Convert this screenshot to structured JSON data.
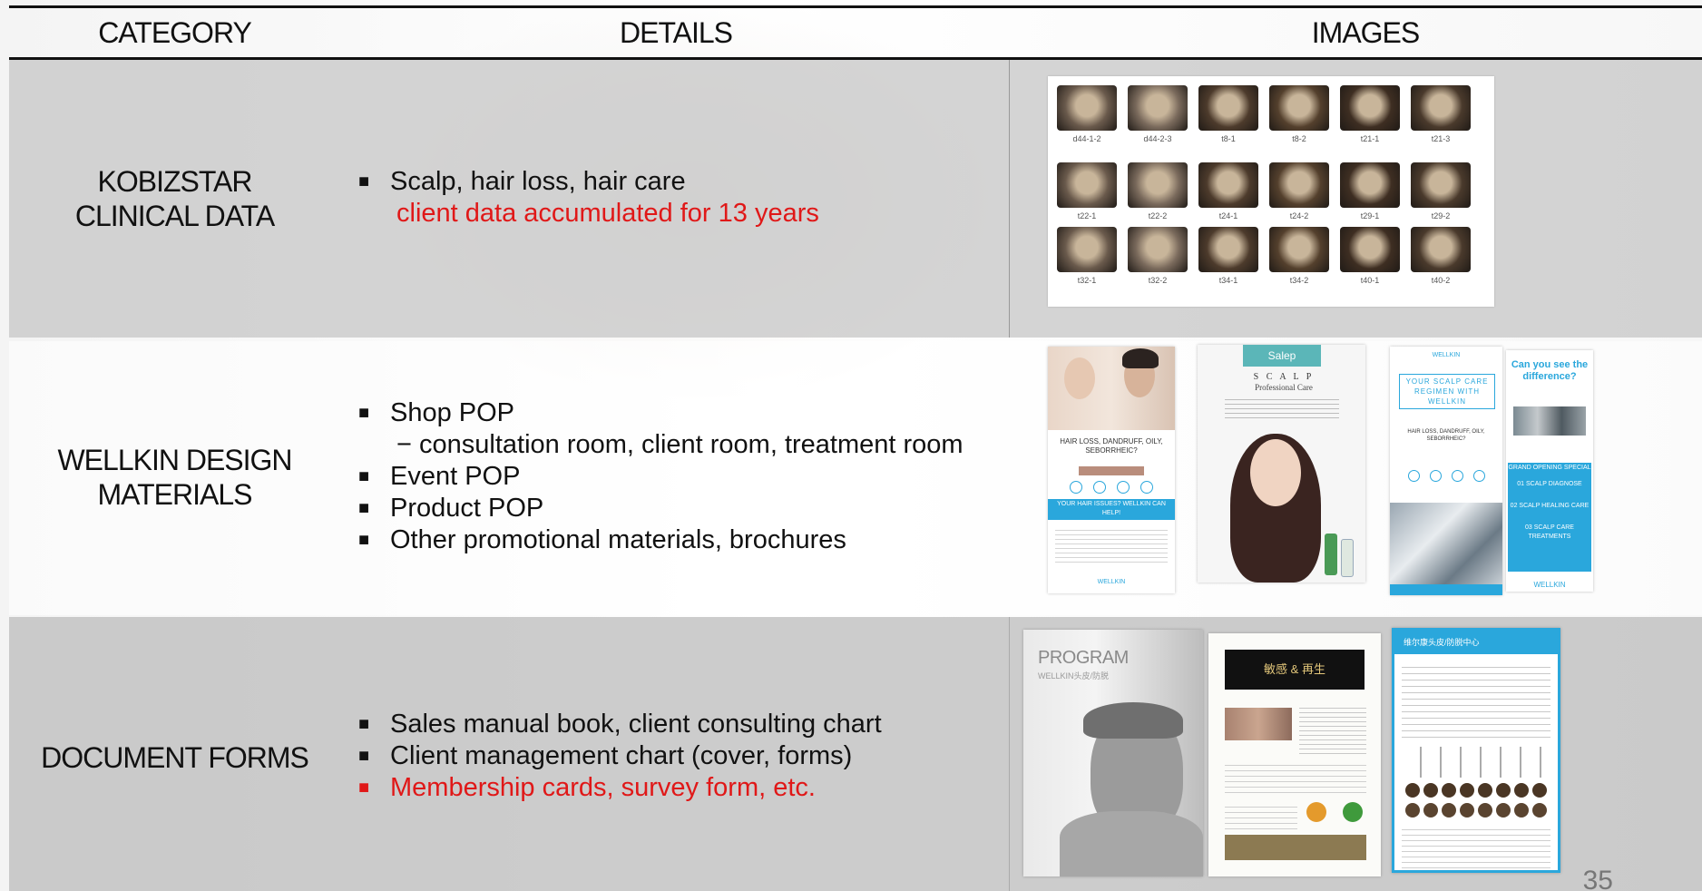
{
  "header": {
    "category": "CATEGORY",
    "details": "DETAILS",
    "images": "IMAGES"
  },
  "rows": [
    {
      "category": [
        "KOBIZSTAR",
        "CLINICAL DATA"
      ],
      "details": [
        {
          "text": "Scalp, hair loss, hair care",
          "bullet": true,
          "red": false
        },
        {
          "text": "client data accumulated for 13 years",
          "bullet": false,
          "red": true
        }
      ]
    },
    {
      "category": [
        "WELLKIN DESIGN",
        "MATERIALS"
      ],
      "details": [
        {
          "text": "Shop POP",
          "bullet": true,
          "red": false
        },
        {
          "text": "− consultation room, client room, treatment room",
          "bullet": false,
          "red": false
        },
        {
          "text": "Event POP",
          "bullet": true,
          "red": false
        },
        {
          "text": "Product POP",
          "bullet": true,
          "red": false
        },
        {
          "text": "Other promotional materials, brochures",
          "bullet": true,
          "red": false
        }
      ]
    },
    {
      "category": [
        "DOCUMENT FORMS"
      ],
      "details": [
        {
          "text": "Sales manual book, client consulting chart",
          "bullet": true,
          "red": false
        },
        {
          "text": "Client management chart (cover, forms)",
          "bullet": true,
          "red": false
        },
        {
          "text": "Membership cards, survey form, etc.",
          "bullet": true,
          "red": true
        }
      ]
    }
  ],
  "clinical_captions": [
    "d44-1-2",
    "d44-2-3",
    "t8-1",
    "t8-2",
    "t21-1",
    "t21-3",
    "t22-1",
    "t22-2",
    "t24-1",
    "t24-2",
    "t29-1",
    "t29-2",
    "t32-1",
    "t32-2",
    "t34-1",
    "t34-2",
    "t40-1",
    "t40-2"
  ],
  "materials": {
    "card1_heading": "HAIR LOSS, DANDRUFF, OILY, SEBORRHEIC?",
    "card1_banner": "YOUR HAIR ISSUES? WELLKIN CAN HELP!",
    "card1_logo": "WELLKIN",
    "card2_brand": "Salep",
    "card2_title": "S C A L P",
    "card2_subtitle": "Professional Care",
    "card3_logo": "WELLKIN",
    "card3_title": "YOUR SCALP CARE REGIMEN WITH WELLKIN",
    "card3_heading": "HAIR LOSS, DANDRUFF, OILY, SEBORRHEIC?",
    "card4_heading": "Can you see the difference?",
    "card4_special": "GRAND OPENING SPECIAL",
    "card4_items": [
      "01 SCALP DIAGNOSE",
      "02 SCALP HEALING CARE",
      "03 SCALP CARE TREATMENTS"
    ],
    "card4_logo": "WELLKIN"
  },
  "forms": {
    "program_title": "PROGRAM",
    "program_sub": "WELLKIN头皮/防脱",
    "booklet_title": "敏感 & 再生",
    "chart_title": "维尔康头皮/防脱中心"
  },
  "page_number": "35",
  "colors": {
    "accent_red": "#e01818",
    "brand_blue": "#2aa7dc"
  }
}
